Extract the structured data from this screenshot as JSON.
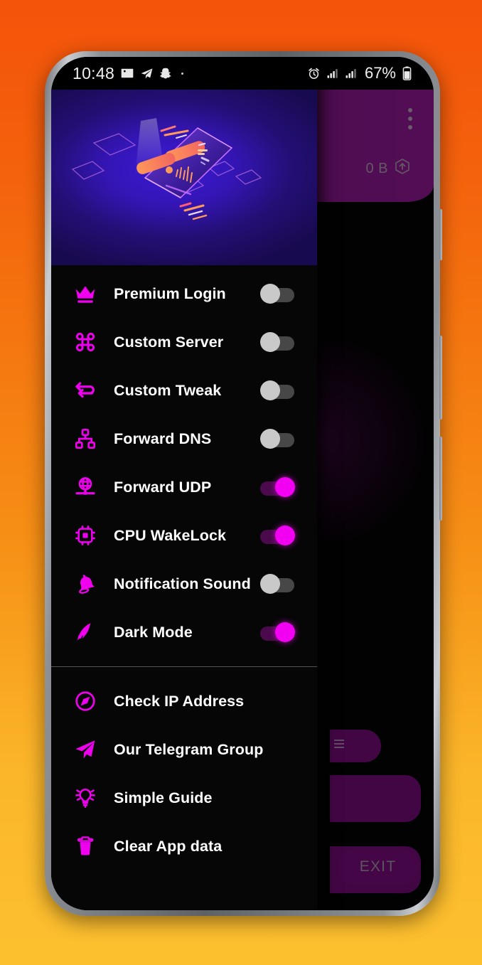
{
  "wallpaper": {
    "top_color": "#f4530a",
    "bottom_color": "#fcc02f"
  },
  "status_bar": {
    "time": "10:48",
    "left_icons": [
      "photo-icon",
      "telegram-icon",
      "snapchat-icon",
      "dot-icon"
    ],
    "right_icons": [
      "alarm-icon",
      "signal-1-icon",
      "signal-2-icon"
    ],
    "battery_percent": "67%",
    "battery_icon": "battery-icon"
  },
  "app": {
    "header": {
      "overflow_icon": "overflow-menu-icon",
      "data_usage": "0 B",
      "upload_icon": "upload-hexagon-icon",
      "color": "#8c168f"
    },
    "exit_button": "EXIT",
    "accent": "#7d0c80"
  },
  "drawer": {
    "header_illustration": "isometric-phone-illustration",
    "toggles": [
      {
        "label": "Premium Login",
        "icon": "crown-icon",
        "state": "off"
      },
      {
        "label": "Custom Server",
        "icon": "command-icon",
        "state": "off"
      },
      {
        "label": "Custom Tweak",
        "icon": "swap-arrows-icon",
        "state": "off"
      },
      {
        "label": "Forward DNS",
        "icon": "sitemap-icon",
        "state": "off"
      },
      {
        "label": "Forward UDP",
        "icon": "globe-stand-icon",
        "state": "on"
      },
      {
        "label": "CPU WakeLock",
        "icon": "cpu-chip-icon",
        "state": "on"
      },
      {
        "label": "Notification Sound",
        "icon": "bell-icon",
        "state": "off"
      },
      {
        "label": "Dark Mode",
        "icon": "moon-icon",
        "state": "on"
      }
    ],
    "links": [
      {
        "label": "Check IP Address",
        "icon": "compass-icon"
      },
      {
        "label": "Our Telegram Group",
        "icon": "paper-plane-icon"
      },
      {
        "label": "Simple Guide",
        "icon": "lightbulb-icon"
      },
      {
        "label": "Clear App data",
        "icon": "trash-icon"
      }
    ],
    "accent_icon_color": "#ef00ef",
    "toggle_on_color": "#f200f2",
    "toggle_off_color": "#c9c9c9"
  }
}
